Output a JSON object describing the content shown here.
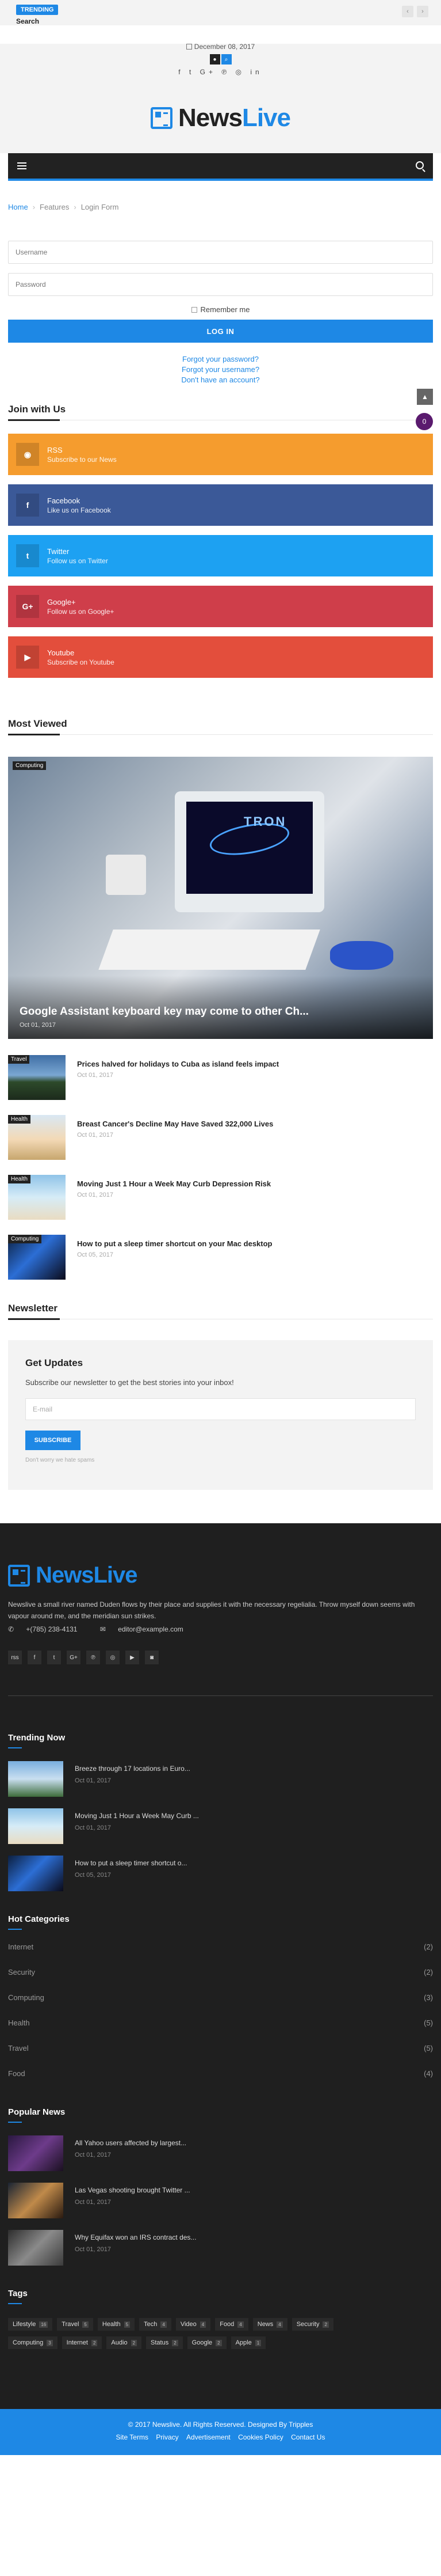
{
  "topbar": {
    "badge": "TRENDING",
    "text": "Search",
    "prev": "‹",
    "next": "›"
  },
  "date": "December 08, 2017",
  "header_social": [
    "f",
    "t",
    "G+",
    "℗",
    "◎",
    "in"
  ],
  "brand": {
    "part1": "News",
    "part2": "Live"
  },
  "breadcrumb": {
    "home": "Home",
    "features": "Features",
    "current": "Login Form"
  },
  "login": {
    "username_placeholder": "Username",
    "password_placeholder": "Password",
    "remember": "Remember me",
    "button": "LOG IN",
    "links": [
      "Forgot your password?",
      "Forgot your username?",
      "Don't have an account?"
    ]
  },
  "join": {
    "title": "Join with Us",
    "counter": "0",
    "items": [
      {
        "icon": "rss",
        "glyph": "◉",
        "title": "RSS",
        "sub": "Subscribe to our News",
        "color": "#f59c2e"
      },
      {
        "icon": "facebook",
        "glyph": "f",
        "title": "Facebook",
        "sub": "Like us on Facebook",
        "color": "#3b5998"
      },
      {
        "icon": "twitter",
        "glyph": "t",
        "title": "Twitter",
        "sub": "Follow us on Twitter",
        "color": "#1da1f2"
      },
      {
        "icon": "google-plus",
        "glyph": "G+",
        "title": "Google+",
        "sub": "Follow us on Google+",
        "color": "#cf3e4a"
      },
      {
        "icon": "youtube",
        "glyph": "▶",
        "title": "Youtube",
        "sub": "Subscribe on Youtube",
        "color": "#e34e3c"
      }
    ]
  },
  "most_viewed": {
    "title": "Most Viewed",
    "hero": {
      "category": "Computing",
      "title": "Google Assistant keyboard key may come to other Ch...",
      "date": "Oct 01, 2017",
      "screen_text": "TRON"
    },
    "items": [
      {
        "category": "Travel",
        "title": "Prices halved for holidays to Cuba as island feels impact",
        "date": "Oct 01, 2017",
        "bg": "linear-gradient(180deg,#3f6ea5 0%,#7aa7d2 45%,#2d4a2a 60%,#1c2a1c 100%)"
      },
      {
        "category": "Health",
        "title": "Breast Cancer's Decline May Have Saved 322,000 Lives",
        "date": "Oct 01, 2017",
        "bg": "linear-gradient(180deg,#d9e8f4 0%,#f3d9b5 55%,#c7a66e 100%)"
      },
      {
        "category": "Health",
        "title": "Moving Just 1 Hour a Week May Curb Depression Risk",
        "date": "Oct 01, 2017",
        "bg": "linear-gradient(180deg,#8fc3e8 0%,#d6ecf7 50%,#e9dcc2 100%)"
      },
      {
        "category": "Computing",
        "title": "How to put a sleep timer shortcut on your Mac desktop",
        "date": "Oct 05, 2017",
        "bg": "linear-gradient(135deg,#0c1f3f 0%,#2c6ed5 45%,#0a0a1a 100%)"
      }
    ]
  },
  "newsletter": {
    "title": "Newsletter",
    "heading": "Get Updates",
    "text": "Subscribe our newsletter to get the best stories into your inbox!",
    "placeholder": "E-mail",
    "button": "SUBSCRIBE",
    "note": "Don't worry we hate spams"
  },
  "footer": {
    "about": "Newslive a small river named Duden flows by their place and supplies it with the necessary regelialia. Throw myself down seems with vapour around me, and the meridian sun strikes.",
    "phone": "+(785) 238-4131",
    "email": "editor@example.com",
    "social": [
      "rss",
      "f",
      "t",
      "G+",
      "℗",
      "◎",
      "▶",
      "◙"
    ],
    "trending": {
      "title": "Trending Now",
      "items": [
        {
          "title": "Breeze through 17 locations in Euro...",
          "date": "Oct 01, 2017",
          "bg": "linear-gradient(180deg,#79aede 0%,#c9dff0 50%,#3d6b3a 100%)"
        },
        {
          "title": "Moving Just 1 Hour a Week May Curb ...",
          "date": "Oct 01, 2017",
          "bg": "linear-gradient(180deg,#8fc3e8 0%,#d6ecf7 50%,#e9dcc2 100%)"
        },
        {
          "title": "How to put a sleep timer shortcut o...",
          "date": "Oct 05, 2017",
          "bg": "linear-gradient(135deg,#0c1f3f 0%,#2c6ed5 45%,#0a0a1a 100%)"
        }
      ]
    },
    "categories": {
      "title": "Hot Categories",
      "items": [
        {
          "name": "Internet",
          "count": "(2)"
        },
        {
          "name": "Security",
          "count": "(2)"
        },
        {
          "name": "Computing",
          "count": "(3)"
        },
        {
          "name": "Health",
          "count": "(5)"
        },
        {
          "name": "Travel",
          "count": "(5)"
        },
        {
          "name": "Food",
          "count": "(4)"
        }
      ]
    },
    "popular": {
      "title": "Popular News",
      "items": [
        {
          "title": "All Yahoo users affected by largest...",
          "date": "Oct 01, 2017",
          "bg": "linear-gradient(135deg,#2a1840 0%,#6d3b8a 50%,#1a1020 100%)"
        },
        {
          "title": "Las Vegas shooting brought Twitter ...",
          "date": "Oct 01, 2017",
          "bg": "linear-gradient(135deg,#1a2433 0%,#c08a4a 50%,#2a1a10 100%)"
        },
        {
          "title": "Why Equifax won an IRS contract des...",
          "date": "Oct 01, 2017",
          "bg": "linear-gradient(135deg,#2d2d2d 0%,#8a8a8a 50%,#3b3b3b 100%)"
        }
      ]
    },
    "tags": {
      "title": "Tags",
      "items": [
        {
          "name": "Lifestyle",
          "count": "16"
        },
        {
          "name": "Travel",
          "count": "5"
        },
        {
          "name": "Health",
          "count": "5"
        },
        {
          "name": "Tech",
          "count": "4"
        },
        {
          "name": "Video",
          "count": "4"
        },
        {
          "name": "Food",
          "count": "4"
        },
        {
          "name": "News",
          "count": "4"
        },
        {
          "name": "Security",
          "count": "2"
        },
        {
          "name": "Computing",
          "count": "3"
        },
        {
          "name": "Internet",
          "count": "2"
        },
        {
          "name": "Audio",
          "count": "2"
        },
        {
          "name": "Status",
          "count": "2"
        },
        {
          "name": "Google",
          "count": "2"
        },
        {
          "name": "Apple",
          "count": "1"
        }
      ]
    },
    "copyright": "© 2017 Newslive. All Rights Reserved. Designed By Tripples",
    "links": [
      "Site Terms",
      "Privacy",
      "Advertisement",
      "Cookies Policy",
      "Contact Us"
    ]
  }
}
